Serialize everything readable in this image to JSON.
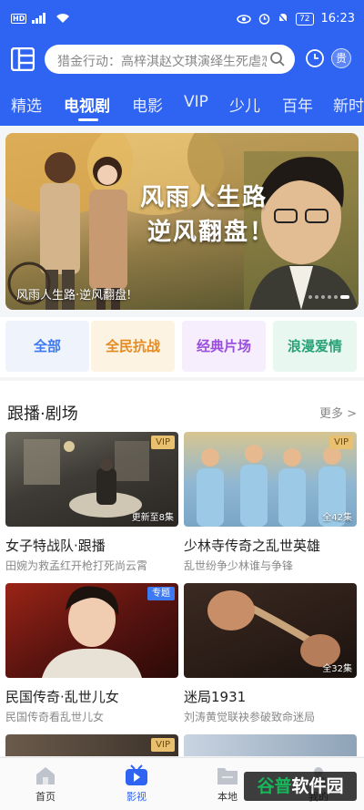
{
  "status_bar": {
    "network": "HD",
    "signal_label": "5G",
    "battery": "72",
    "time": "16:23"
  },
  "search": {
    "placeholder": "猎金行动：高梓淇赵文琪演绎生死虐恋"
  },
  "header": {
    "vip_avatar_text": "贵"
  },
  "tabs": [
    {
      "label": "精选"
    },
    {
      "label": "电视剧",
      "active": true
    },
    {
      "label": "电影"
    },
    {
      "label": "VIP"
    },
    {
      "label": "少儿"
    },
    {
      "label": "百年"
    },
    {
      "label": "新时"
    }
  ],
  "banner": {
    "title_line1": "风雨人生路",
    "title_line2": "逆风翻盘！",
    "caption": "风雨人生路·逆风翻盘!",
    "slides_total": 6,
    "slide_active": 6
  },
  "categories": [
    {
      "label": "全部",
      "bg": "#eef3fc",
      "color": "#3d79f2"
    },
    {
      "label": "全民抗战",
      "bg": "#fdf3e3",
      "color": "#e68a1f"
    },
    {
      "label": "经典片场",
      "bg": "#f6eefc",
      "color": "#9b4ee0"
    },
    {
      "label": "浪漫爱情",
      "bg": "#e9f7f1",
      "color": "#27a277"
    }
  ],
  "section": {
    "title": "跟播·剧场",
    "more": "更多 >"
  },
  "cards": [
    {
      "title": "女子特战队·跟播",
      "subtitle": "田婉为救孟红开枪打死尚云霄",
      "badge": "VIP",
      "episodes": "更新至8集"
    },
    {
      "title": "少林寺传奇之乱世英雄",
      "subtitle": "乱世纷争少林谁与争锋",
      "badge": "VIP",
      "episodes": "全42集"
    },
    {
      "title": "民国传奇·乱世儿女",
      "subtitle": "民国传奇看乱世儿女",
      "badge": "专题",
      "episodes": ""
    },
    {
      "title": "迷局1931",
      "subtitle": "刘涛黄觉联袂参破致命迷局",
      "badge": "",
      "episodes": "全32集"
    }
  ],
  "partial_card_badge": "VIP",
  "bottom_nav": [
    {
      "label": "首页",
      "icon": "home-icon"
    },
    {
      "label": "影视",
      "icon": "tv-play-icon",
      "active": true
    },
    {
      "label": "本地",
      "icon": "folder-icon"
    },
    {
      "label": "我的",
      "icon": "profile-icon"
    }
  ],
  "watermark": {
    "part1": "谷普",
    "part2": "软件园"
  },
  "colors": {
    "brand_blue": "#2f63f1",
    "vip_gold": "#e8c06f"
  }
}
